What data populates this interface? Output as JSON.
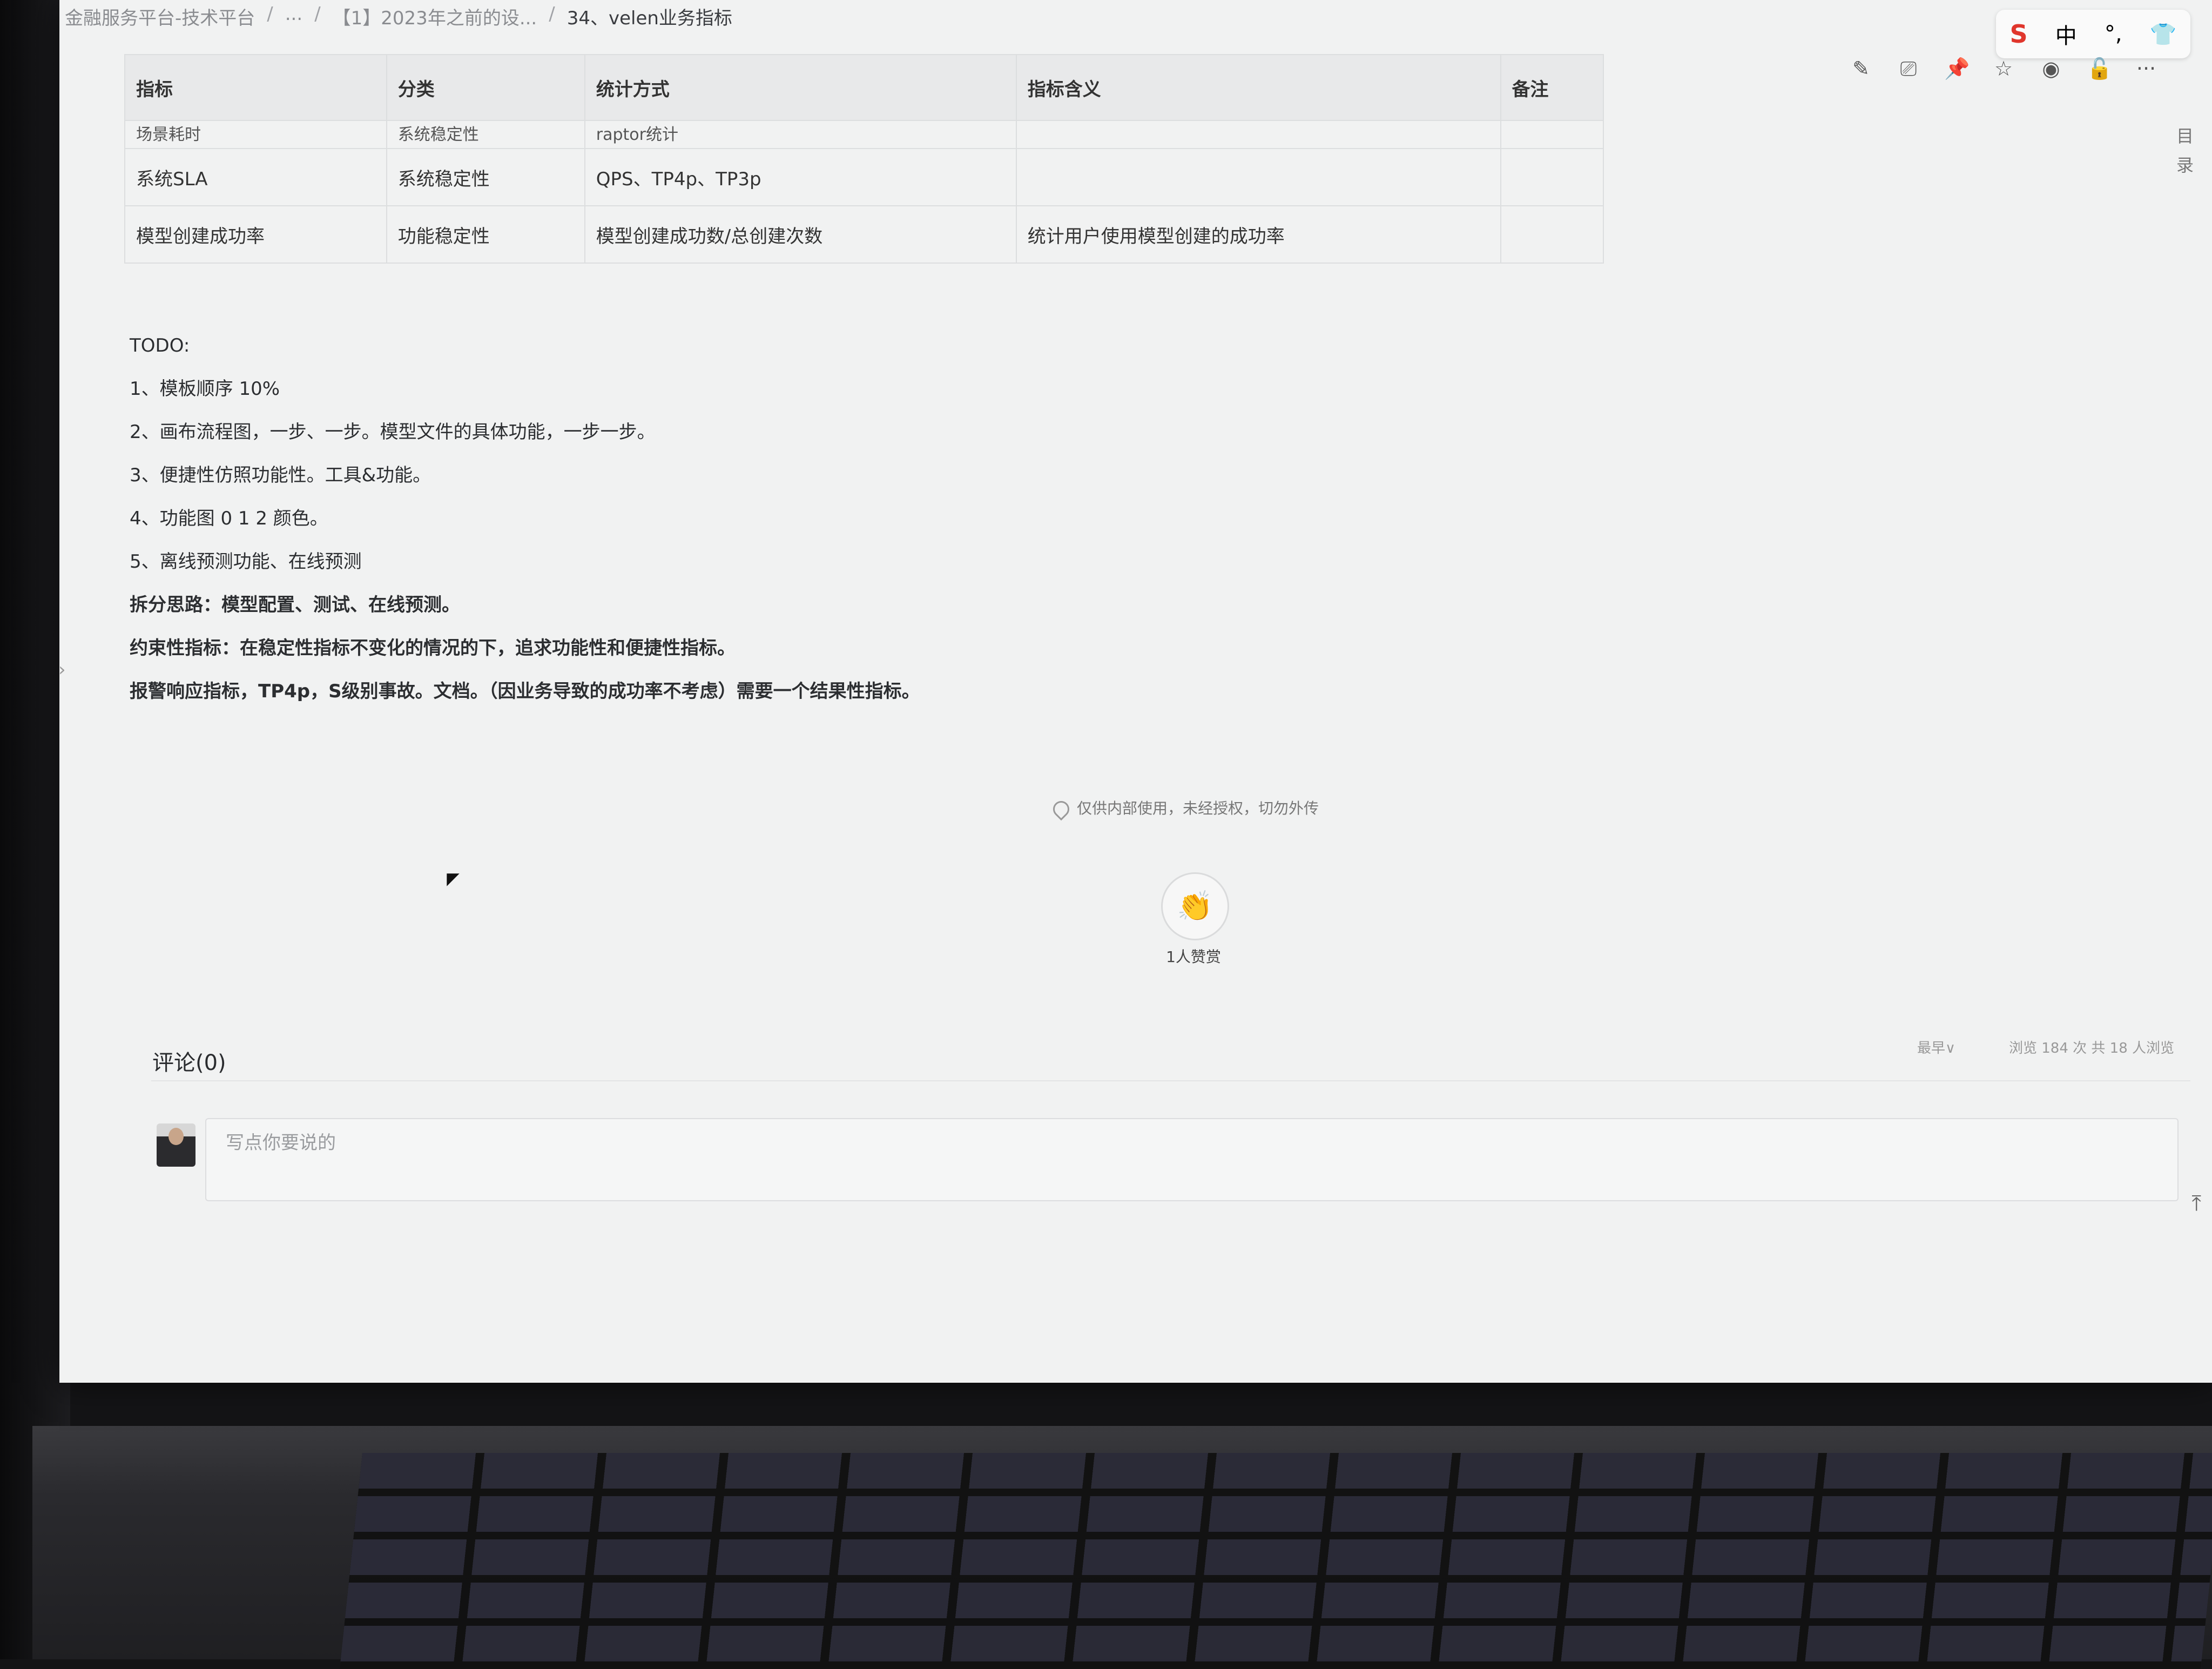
{
  "breadcrumb": {
    "items": [
      "金融服务平台-技术平台",
      "...",
      "【1】2023年之前的设...",
      "34、velen业务指标"
    ],
    "sep": "/"
  },
  "ime": {
    "logo": "S",
    "mode": "中",
    "punct": "°,",
    "skin": "👕"
  },
  "toolbar": {
    "edit": "✎",
    "present": "⎚",
    "pin": "📌",
    "star": "☆",
    "eye": "◉",
    "lock": "🔓",
    "more": "···"
  },
  "toc": {
    "label_1": "目",
    "label_2": "录"
  },
  "table": {
    "headers": [
      "指标",
      "分类",
      "统计方式",
      "指标含义",
      "备注"
    ],
    "cut_row": [
      "场景耗时",
      "系统稳定性",
      "raptor统计",
      "",
      ""
    ],
    "rows": [
      [
        "系统SLA",
        "系统稳定性",
        "QPS、TP4p、TP3p",
        "",
        ""
      ],
      [
        "模型创建成功率",
        "功能稳定性",
        "模型创建成功数/总创建次数",
        "统计用户使用模型创建的成功率",
        ""
      ]
    ]
  },
  "todo": {
    "title": "TODO:",
    "items": [
      "1、模板顺序 10%",
      "2、画布流程图，一步、一步。模型文件的具体功能，一步一步。",
      "3、便捷性仿照功能性。工具&功能。",
      "4、功能图 0 1 2 颜色。",
      "5、离线预测功能、在线预测"
    ],
    "bold_lines": [
      "拆分思路：模型配置、测试、在线预测。",
      "约束性指标：在稳定性指标不变化的情况的下，追求功能性和便捷性指标。",
      "报警响应指标，TP4p，S级别事故。文档。（因业务导致的成功率不考虑）需要一个结果性指标。"
    ]
  },
  "notice": "仅供内部使用，未经授权，切勿外传",
  "like": {
    "emoji": "👏",
    "count_text": "1人赞赏"
  },
  "comments": {
    "title": "评论(0)",
    "sort": "最早∨",
    "views": "浏览 184 次  共 18 人浏览",
    "placeholder": "写点你要说的"
  },
  "misc": {
    "back_top": "⤒",
    "side_toggle": "›"
  }
}
